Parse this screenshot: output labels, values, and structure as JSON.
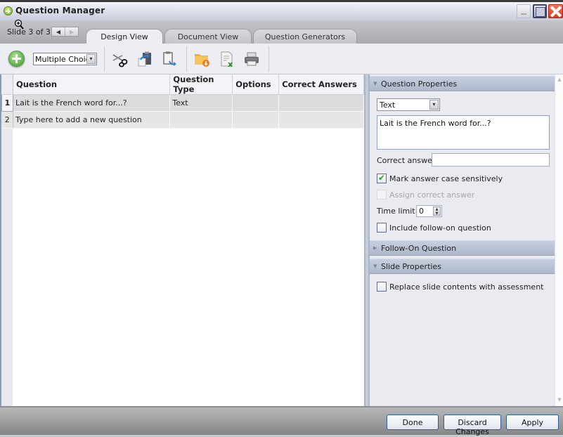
{
  "window": {
    "title": "Question Manager",
    "controls": {
      "minimize": "minimize",
      "maximize": "maximize",
      "close": "close"
    }
  },
  "slide_nav": {
    "label": "Slide 3 of 3",
    "prev": "◀",
    "next": "▶"
  },
  "tabs": [
    {
      "label": "Design View",
      "active": true
    },
    {
      "label": "Document View",
      "active": false
    },
    {
      "label": "Question Generators",
      "active": false
    }
  ],
  "toolbar": {
    "add_icon": "add-question-icon",
    "question_type_select": "Multiple Choice",
    "dropdown_arrow": "▾",
    "icons": [
      "scissors-icon",
      "paste-icon",
      "paste-special-icon",
      "import-folder-icon",
      "export-excel-icon",
      "print-icon"
    ]
  },
  "grid": {
    "columns": [
      "Question",
      "Question Type",
      "Options",
      "Correct Answers"
    ],
    "rows": [
      {
        "num": "1",
        "question": "Lait is the French word for...?",
        "type": "Text",
        "options": "",
        "answers": ""
      },
      {
        "num": "2",
        "question": "Type here to add a new question",
        "type": "",
        "options": "",
        "answers": ""
      }
    ]
  },
  "properties": {
    "question_properties": {
      "header": "Question Properties",
      "expanded": true,
      "type_select": "Text",
      "question_text": "Lait is the French word for...?",
      "correct_answer_label": "Correct answer",
      "correct_answer_value": "",
      "case_sensitive_label": "Mark answer case sensitively",
      "case_sensitive_checked": true,
      "assign_correct_label": "Assign correct answer",
      "assign_correct_checked": false,
      "assign_correct_disabled": true,
      "time_limit_label": "Time limit",
      "time_limit_value": "0",
      "follow_on_label": "Include follow-on question",
      "follow_on_checked": false
    },
    "follow_on_question": {
      "header": "Follow-On Question",
      "expanded": false
    },
    "slide_properties": {
      "header": "Slide Properties",
      "expanded": true,
      "replace_label": "Replace slide contents with assessment",
      "replace_checked": false
    }
  },
  "footer": {
    "done": "Done",
    "discard": "Discard Changes",
    "apply": "Apply"
  }
}
